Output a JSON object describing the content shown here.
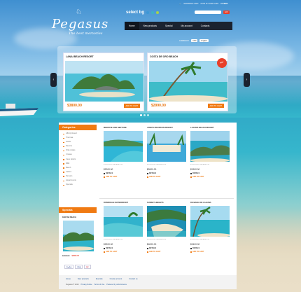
{
  "header": {
    "logo_name": "Pegasus",
    "logo_slogan": "The best memories",
    "select_bg_label": "select bg",
    "bg_colors": [
      "#3c97d6",
      "#3cb2c8",
      "#a8d24a"
    ],
    "topbar": {
      "cart_label": "SHOPPING CART",
      "cart_status": "NOW IN YOUR CART",
      "cart_count": "0 ITEMS"
    },
    "search": {
      "placeholder": "",
      "button_label": "GO!"
    },
    "nav": [
      "Home",
      "New products",
      "Special",
      "My account",
      "Contacts"
    ],
    "currency_label": "CURRENCY",
    "currency_value": "USD",
    "language_value": "English"
  },
  "slider": {
    "slides": [
      {
        "title": "LANAI BEACH RESORT",
        "price": "$3800.00",
        "button": "ADD TO CART"
      },
      {
        "title": "COSTA DE ORO BEACH",
        "price": "$2990.00",
        "button": "ADD TO CART",
        "badge": "HOT"
      }
    ],
    "prev_icon": "‹",
    "next_icon": "›"
  },
  "sidebar": {
    "categories_title": "Categories",
    "categories": [
      "Affinity Resort",
      "Thermae",
      "Hotels",
      "Resorts",
      "Villa rentals",
      "Cruises",
      "Cave Hotels",
      "B&B",
      "Beach",
      "Cabins",
      "Pension",
      "Appartments",
      "Specials"
    ],
    "specials_title": "Specials",
    "special_item": {
      "name": "KENYAN BEACH",
      "old_price": "$4200.00",
      "new_price": "$3900.00"
    },
    "payments": [
      "PayPal",
      "VISA",
      "MC"
    ]
  },
  "products": [
    {
      "title": "MERITIVE AND NEPTUNE",
      "desc": "EXCELLENT RELAXATION",
      "price": "$2000.00",
      "details": "DETAILS",
      "cart": "ADD TO CART"
    },
    {
      "title": "JOHN'S MOUNTAIN RESORT",
      "desc": "EXCELLENT RELAXATION",
      "price": "$2600.00",
      "details": "DETAILS",
      "cart": "ADD TO CART"
    },
    {
      "title": "LAGUNA BEACH RESORT",
      "desc": "EXCELLENT RELAXATION",
      "price": "$1900.00",
      "details": "DETAILS",
      "cart": "ADD TO CART"
    },
    {
      "title": "RIVERDALE WATERFRONT",
      "desc": "EXCELLENT RELAXATION",
      "price": "$2900.00",
      "details": "DETAILS",
      "cart": "ADD TO CART"
    },
    {
      "title": "SUNSET HEIGHTS",
      "desc": "EXCELLENT RELAXATION",
      "price": "$4000.00",
      "details": "DETAILS",
      "cart": "ADD TO CART"
    },
    {
      "title": "DE BAHIA DE LAGUNA",
      "desc": "EXCELLENT RELAXATION",
      "price": "$2400.00",
      "details": "DETAILS",
      "cart": "ADD TO CART"
    }
  ],
  "footer": {
    "links": [
      "Home",
      "New products",
      "Specials",
      "Create account",
      "Contact us"
    ],
    "copyright": "Pegasus © 2013",
    "privacy": "Privacy Notice",
    "terms": "Terms of Use",
    "powered": "Powered by osCommerce"
  },
  "colors": {
    "accent": "#f07a12",
    "nav_bg": "#1b2330",
    "price": "#e8740c"
  }
}
